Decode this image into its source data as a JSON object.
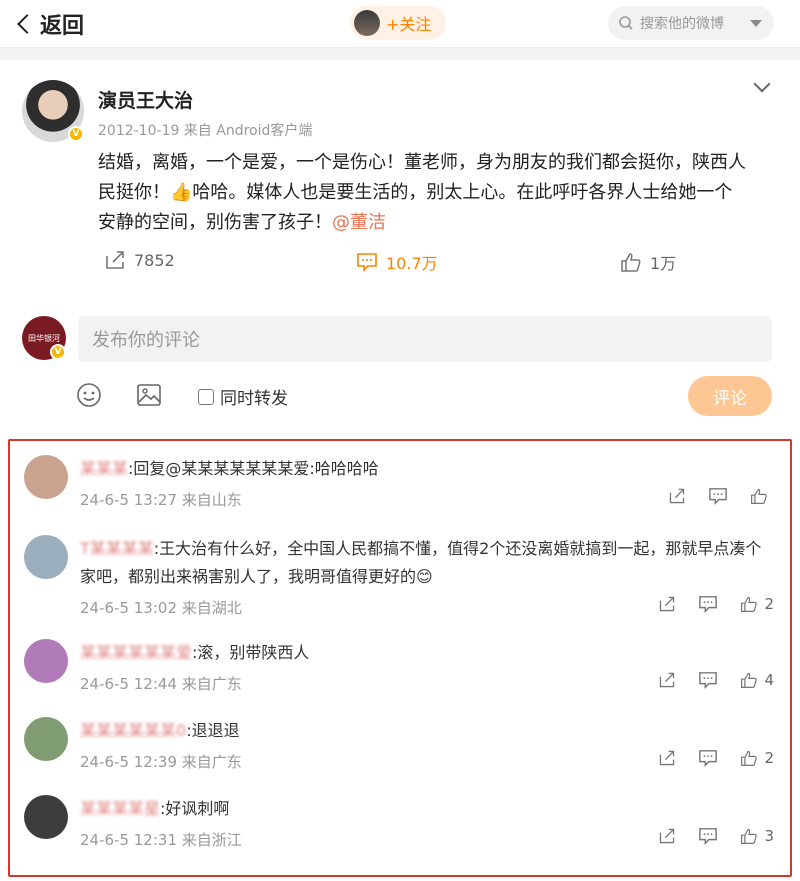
{
  "topbar": {
    "back_label": "返回",
    "follow_label": "+关注",
    "search_placeholder": "搜索他的微博"
  },
  "post": {
    "author": "演员王大治",
    "meta": "2012-10-19  来自 Android客户端",
    "text_line1": "结婚，离婚，一个是爱，一个是伤心！董老师，身为朋友的我们都会挺你，陕西人",
    "text_line2_a": "民挺你！",
    "text_line2_emoji": "👍",
    "text_line2_b": "哈哈。媒体人也是要生活的，别太上心。在此呼吁各界人士给她一个",
    "text_line3_a": "安静的空间，别伤害了孩子！",
    "mention": "@董洁",
    "reposts": "7852",
    "comments": "10.7万",
    "likes": "1万"
  },
  "composer": {
    "avatar_text": "田华银河",
    "placeholder": "发布你的评论",
    "repost_label": "同时转发",
    "submit_label": "评论"
  },
  "comments": [
    {
      "user": "某某某",
      "text": ":回复@某某某某某某某爱:哈哈哈哈",
      "time": "24-6-5 13:27  来自山东",
      "likes": "",
      "color": "#c9a38e"
    },
    {
      "user": "T某某某某",
      "text": ":王大治有什么好，全中国人民都搞不懂，值得2个还没离婚就搞到一起，那就早点凑个",
      "text2": "家吧，都别出来祸害别人了，我明哥值得更好的😊",
      "time": "24-6-5 13:02  来自湖北",
      "likes": "2",
      "color": "#9aaebe"
    },
    {
      "user": "某某某某某某爱",
      "text": ":滚，别带陕西人",
      "time": "24-6-5 12:44  来自广东",
      "likes": "4",
      "color": "#b07bb8"
    },
    {
      "user": "某某某某某某0",
      "text": ":退退退",
      "time": "24-6-5 12:39  来自广东",
      "likes": "2",
      "color": "#7f9c72"
    },
    {
      "user": "某某某某星",
      "text": ":好讽刺啊",
      "time": "24-6-5 12:31  来自浙江",
      "likes": "3",
      "color": "#3d3d3d"
    }
  ]
}
